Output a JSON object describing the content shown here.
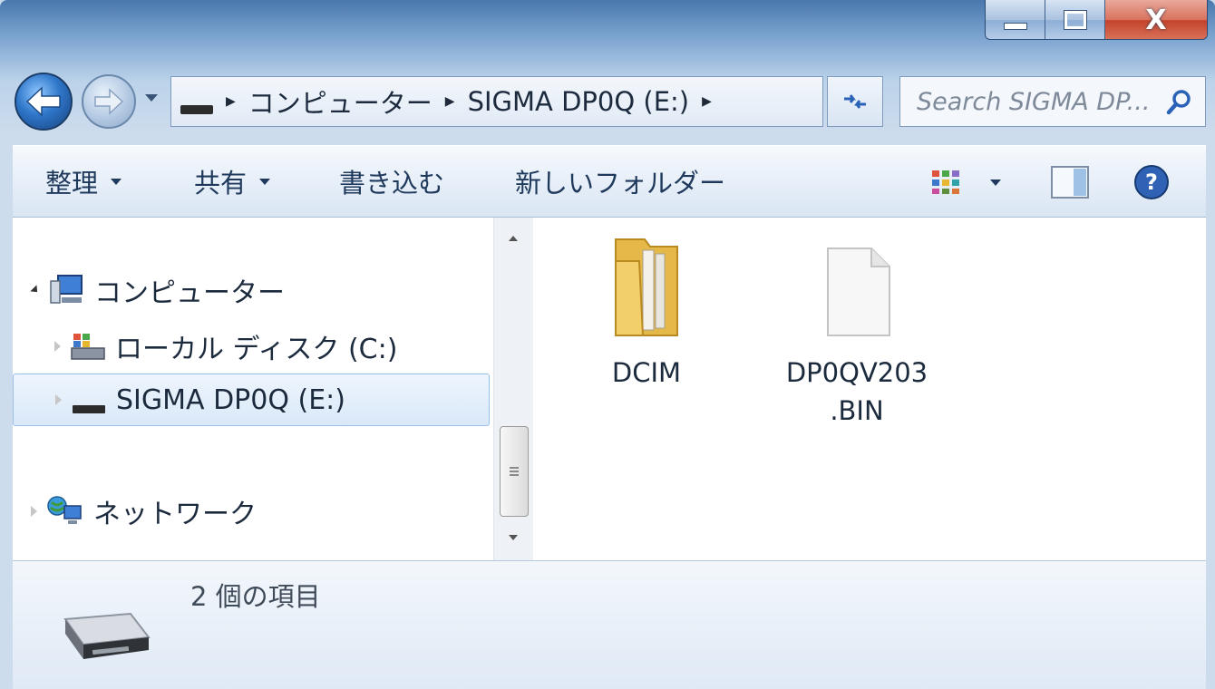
{
  "window": {
    "caption_close": "X"
  },
  "address_bar": {
    "breadcrumbs": [
      "コンピューター",
      "SIGMA DP0Q (E:)"
    ],
    "search_placeholder": "Search SIGMA DP..."
  },
  "toolbar": {
    "organize_label": "整理",
    "share_label": "共有",
    "burn_label": "書き込む",
    "new_folder_label": "新しいフォルダー"
  },
  "nav_pane": {
    "items": [
      {
        "label": "コンピューター",
        "icon": "computer-icon"
      },
      {
        "label": "ローカル ディスク (C:)",
        "icon": "local-disk-icon"
      },
      {
        "label": "SIGMA DP0Q (E:)",
        "icon": "removable-drive-icon",
        "selected": true
      },
      {
        "label": "ネットワーク",
        "icon": "network-icon"
      }
    ]
  },
  "files": [
    {
      "name": "DCIM",
      "icon": "folder-icon"
    },
    {
      "name_line1": "DP0QV203",
      "name_line2": ".BIN",
      "icon": "file-icon"
    }
  ],
  "details": {
    "item_count": "2 個の項目"
  },
  "colors": {
    "title_bar": "#4a78ad",
    "toolbar_bg": "#e6eef8",
    "selection": "#d9e8f8",
    "close_button": "#c4422a"
  }
}
